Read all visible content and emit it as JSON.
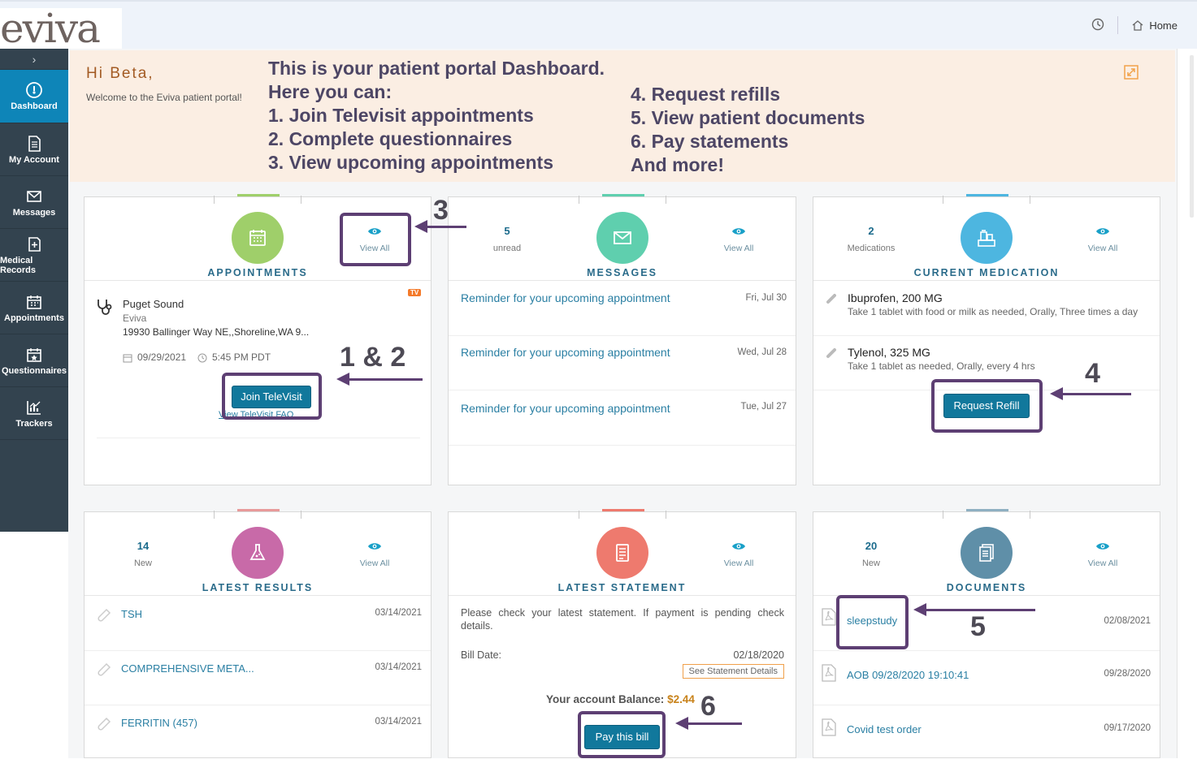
{
  "app": {
    "logo_text": "eviva"
  },
  "header": {
    "history_icon": "history-icon",
    "home_label": "Home"
  },
  "sidebar": {
    "toggle": "›",
    "items": [
      {
        "label": "Dashboard",
        "icon": "dashboard-icon",
        "active": true
      },
      {
        "label": "My Account",
        "icon": "document-icon"
      },
      {
        "label": "Messages",
        "icon": "envelope-icon"
      },
      {
        "label": "Medical Records",
        "icon": "medical-records-icon"
      },
      {
        "label": "Appointments",
        "icon": "calendar-icon"
      },
      {
        "label": "Questionnaires",
        "icon": "questionnaire-icon"
      },
      {
        "label": "Trackers",
        "icon": "chart-icon"
      }
    ]
  },
  "banner": {
    "greeting": "Hi Beta,",
    "welcome": "Welcome to the Eviva patient portal!",
    "promo_left": [
      "This is your patient portal Dashboard.",
      "Here you can:",
      "1. Join Televisit appointments",
      "2. Complete questionnaires",
      "3. View upcoming appointments"
    ],
    "promo_right": [
      "4. Request refills",
      "5. View patient documents",
      "6. Pay statements",
      "And more!"
    ]
  },
  "appointments": {
    "title": "APPOINTMENTS",
    "view_all": "View All",
    "badge": "TV",
    "location": "Puget Sound",
    "org": "Eviva",
    "address": "19930 Ballinger Way NE,,Shoreline,WA 9...",
    "date": "09/29/2021",
    "time": "5:45 PM PDT",
    "join_button": "Join TeleVisit",
    "faq_link": "View TeleVisit FAQ"
  },
  "messages": {
    "title": "MESSAGES",
    "count": "5",
    "count_label": "unread",
    "view_all": "View All",
    "items": [
      {
        "subject": "Reminder for your upcoming appointment",
        "date": "Fri, Jul 30"
      },
      {
        "subject": "Reminder for your upcoming appointment",
        "date": "Wed, Jul 28"
      },
      {
        "subject": "Reminder for your upcoming appointment",
        "date": "Tue, Jul 27"
      }
    ]
  },
  "medication": {
    "title": "CURRENT MEDICATION",
    "count": "2",
    "count_label": "Medications",
    "view_all": "View All",
    "items": [
      {
        "name": "Ibuprofen, 200 MG",
        "directions": "Take 1 tablet with food or milk as needed, Orally, Three times a day"
      },
      {
        "name": "Tylenol, 325 MG",
        "directions": "Take 1 tablet as needed, Orally, every 4 hrs"
      }
    ],
    "refill_button": "Request Refill"
  },
  "results": {
    "title": "LATEST RESULTS",
    "count": "14",
    "count_label": "New",
    "view_all": "View All",
    "items": [
      {
        "name": "TSH",
        "date": "03/14/2021"
      },
      {
        "name": "COMPREHENSIVE META...",
        "date": "03/14/2021"
      },
      {
        "name": "FERRITIN (457)",
        "date": "03/14/2021"
      }
    ]
  },
  "statement": {
    "title": "LATEST STATEMENT",
    "view_all": "View All",
    "note": "Please check your latest statement. If payment is pending check details.",
    "bill_date_label": "Bill Date:",
    "bill_date": "02/18/2020",
    "details_button": "See Statement Details",
    "balance_label": "Your account Balance:",
    "balance": "$2.44",
    "pay_button": "Pay this bill"
  },
  "documents": {
    "title": "DOCUMENTS",
    "count": "20",
    "count_label": "New",
    "view_all": "View All",
    "items": [
      {
        "name": "sleepstudy",
        "date": "02/08/2021"
      },
      {
        "name": "AOB 09/28/2020 19:10:41",
        "date": "09/28/2020"
      },
      {
        "name": "Covid test order",
        "date": "09/17/2020"
      }
    ]
  },
  "annotations": {
    "n3": "3",
    "n12": "1 & 2",
    "n4": "4",
    "n5": "5",
    "n6": "6"
  },
  "colors": {
    "sidebar": "#33434f",
    "active": "#0e85b8",
    "banner": "#fbeee3",
    "annotation": "#5d3f73",
    "appointments": "#9fcf6a",
    "messages": "#5fcfae",
    "medication": "#4db6e0",
    "results": "#c86aa8",
    "statement": "#ee7a6e",
    "documents": "#5f8fa8"
  }
}
